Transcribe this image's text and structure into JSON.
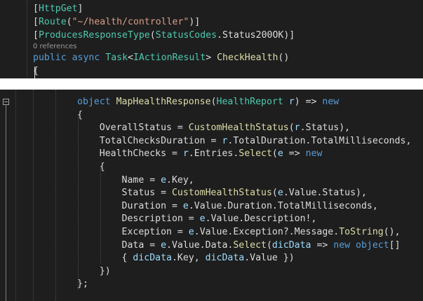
{
  "colors": {
    "background": "#1e1e1e",
    "default_text": "#dcdcdc",
    "keyword": "#569cd6",
    "type": "#4ec9b0",
    "method": "#dcdcaa",
    "string": "#d69d85",
    "parameter": "#9cdcfe",
    "codelens": "#999999"
  },
  "top_editor": {
    "codelens": "0 references",
    "lines": [
      [
        {
          "t": "[",
          "c": "default_text"
        },
        {
          "t": "HttpGet",
          "c": "type"
        },
        {
          "t": "]",
          "c": "default_text"
        }
      ],
      [
        {
          "t": "[",
          "c": "default_text"
        },
        {
          "t": "Route",
          "c": "type"
        },
        {
          "t": "(",
          "c": "default_text"
        },
        {
          "t": "\"~/health/controller\"",
          "c": "string"
        },
        {
          "t": ")]",
          "c": "default_text"
        }
      ],
      [
        {
          "t": "[",
          "c": "default_text"
        },
        {
          "t": "ProducesResponseType",
          "c": "type"
        },
        {
          "t": "(",
          "c": "default_text"
        },
        {
          "t": "StatusCodes",
          "c": "type"
        },
        {
          "t": ".Status200OK)]",
          "c": "default_text"
        }
      ],
      [
        {
          "t": "public",
          "c": "keyword"
        },
        {
          "t": " ",
          "c": "default_text"
        },
        {
          "t": "async",
          "c": "keyword"
        },
        {
          "t": " ",
          "c": "default_text"
        },
        {
          "t": "Task",
          "c": "type"
        },
        {
          "t": "<",
          "c": "default_text"
        },
        {
          "t": "IActionResult",
          "c": "type"
        },
        {
          "t": "> ",
          "c": "default_text"
        },
        {
          "t": "CheckHealth",
          "c": "method"
        },
        {
          "t": "()",
          "c": "default_text"
        }
      ],
      [
        {
          "t": "{",
          "c": "default_text"
        }
      ]
    ]
  },
  "bottom_editor": {
    "lines": [
      [
        {
          "t": "object",
          "c": "keyword"
        },
        {
          "t": " ",
          "c": "default_text"
        },
        {
          "t": "MapHealthResponse",
          "c": "method"
        },
        {
          "t": "(",
          "c": "default_text"
        },
        {
          "t": "HealthReport",
          "c": "type"
        },
        {
          "t": " ",
          "c": "default_text"
        },
        {
          "t": "r",
          "c": "parameter"
        },
        {
          "t": ") => ",
          "c": "default_text"
        },
        {
          "t": "new",
          "c": "keyword"
        }
      ],
      [
        {
          "t": "{",
          "c": "default_text"
        }
      ],
      [
        {
          "t": "    OverallStatus = ",
          "c": "default_text"
        },
        {
          "t": "CustomHealthStatus",
          "c": "method"
        },
        {
          "t": "(",
          "c": "default_text"
        },
        {
          "t": "r",
          "c": "parameter"
        },
        {
          "t": ".Status),",
          "c": "default_text"
        }
      ],
      [
        {
          "t": "    TotalChecksDuration = ",
          "c": "default_text"
        },
        {
          "t": "r",
          "c": "parameter"
        },
        {
          "t": ".TotalDuration.TotalMilliseconds,",
          "c": "default_text"
        }
      ],
      [
        {
          "t": "    HealthChecks = ",
          "c": "default_text"
        },
        {
          "t": "r",
          "c": "parameter"
        },
        {
          "t": ".Entries.",
          "c": "default_text"
        },
        {
          "t": "Select",
          "c": "method"
        },
        {
          "t": "(",
          "c": "default_text"
        },
        {
          "t": "e",
          "c": "parameter"
        },
        {
          "t": " => ",
          "c": "default_text"
        },
        {
          "t": "new",
          "c": "keyword"
        }
      ],
      [
        {
          "t": "    {",
          "c": "default_text"
        }
      ],
      [
        {
          "t": "        Name = ",
          "c": "default_text"
        },
        {
          "t": "e",
          "c": "parameter"
        },
        {
          "t": ".Key,",
          "c": "default_text"
        }
      ],
      [
        {
          "t": "        Status = ",
          "c": "default_text"
        },
        {
          "t": "CustomHealthStatus",
          "c": "method"
        },
        {
          "t": "(",
          "c": "default_text"
        },
        {
          "t": "e",
          "c": "parameter"
        },
        {
          "t": ".Value.Status),",
          "c": "default_text"
        }
      ],
      [
        {
          "t": "        Duration = ",
          "c": "default_text"
        },
        {
          "t": "e",
          "c": "parameter"
        },
        {
          "t": ".Value.Duration.TotalMilliseconds,",
          "c": "default_text"
        }
      ],
      [
        {
          "t": "        Description = ",
          "c": "default_text"
        },
        {
          "t": "e",
          "c": "parameter"
        },
        {
          "t": ".Value.Description!,",
          "c": "default_text"
        }
      ],
      [
        {
          "t": "        Exception = ",
          "c": "default_text"
        },
        {
          "t": "e",
          "c": "parameter"
        },
        {
          "t": ".Value.Exception?.Message.",
          "c": "default_text"
        },
        {
          "t": "ToString",
          "c": "method"
        },
        {
          "t": "(),",
          "c": "default_text"
        }
      ],
      [
        {
          "t": "        Data = ",
          "c": "default_text"
        },
        {
          "t": "e",
          "c": "parameter"
        },
        {
          "t": ".Value.Data.",
          "c": "default_text"
        },
        {
          "t": "Select",
          "c": "method"
        },
        {
          "t": "(",
          "c": "default_text"
        },
        {
          "t": "dicData",
          "c": "parameter"
        },
        {
          "t": " => ",
          "c": "default_text"
        },
        {
          "t": "new",
          "c": "keyword"
        },
        {
          "t": " ",
          "c": "default_text"
        },
        {
          "t": "object",
          "c": "keyword"
        },
        {
          "t": "[]",
          "c": "default_text"
        }
      ],
      [
        {
          "t": "        { ",
          "c": "default_text"
        },
        {
          "t": "dicData",
          "c": "parameter"
        },
        {
          "t": ".Key, ",
          "c": "default_text"
        },
        {
          "t": "dicData",
          "c": "parameter"
        },
        {
          "t": ".Value })",
          "c": "default_text"
        }
      ],
      [
        {
          "t": "    })",
          "c": "default_text"
        }
      ],
      [
        {
          "t": "};",
          "c": "default_text"
        }
      ]
    ]
  }
}
